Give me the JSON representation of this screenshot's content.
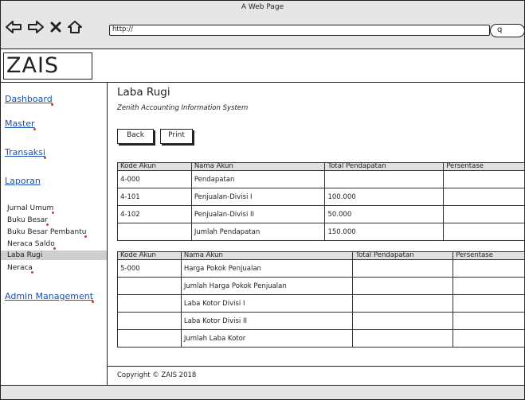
{
  "window": {
    "title": "A Web Page",
    "url": "http://"
  },
  "icons": {
    "back": "arrow-left-icon",
    "forward": "arrow-right-icon",
    "stop": "close-icon",
    "home": "home-icon",
    "search": "search-icon"
  },
  "search": {
    "glyph": "q"
  },
  "app": {
    "logo": "ZAIS"
  },
  "sidebar": {
    "dashboard": "Dashboard",
    "master": "Master",
    "transaksi": "Transaksi",
    "laporan": "Laporan",
    "laporan_items": [
      "Jurnal Umum",
      "Buku Besar",
      "Buku Besar Pembantu",
      "Neraca Saldo",
      "Laba Rugi",
      "Neraca"
    ],
    "admin": "Admin Management"
  },
  "page": {
    "title": "Laba Rugi",
    "subtitle": "Zenith Accounting Information System",
    "back_label": "Back",
    "print_label": "Print"
  },
  "table1": {
    "headers": [
      "Kode Akun",
      "Nama Akun",
      "Total Pendapatan",
      "Persentase"
    ],
    "rows": [
      [
        "4-000",
        "Pendapatan",
        "",
        ""
      ],
      [
        "4-101",
        "Penjualan-Divisi I",
        "100.000",
        ""
      ],
      [
        "4-102",
        "Penjualan-Divisi II",
        "50.000",
        ""
      ],
      [
        "",
        "Jumlah Pendapatan",
        "150.000",
        ""
      ]
    ]
  },
  "table2": {
    "headers": [
      "Kode Akun",
      "Nama Akun",
      "Total Pendapatan",
      "Persentase"
    ],
    "rows": [
      [
        "5-000",
        "Harga Pokok Penjualan",
        "",
        ""
      ],
      [
        "",
        "Jumlah Harga Pokok Penjualan",
        "",
        ""
      ],
      [
        "",
        "Laba Kotor Divisi I",
        "",
        ""
      ],
      [
        "",
        "Laba Kotor Divisi II",
        "",
        ""
      ],
      [
        "",
        "Jumlah Laba Kotor",
        "",
        ""
      ]
    ]
  },
  "footer": {
    "copyright": "Copyright © ZAIS 2018"
  }
}
